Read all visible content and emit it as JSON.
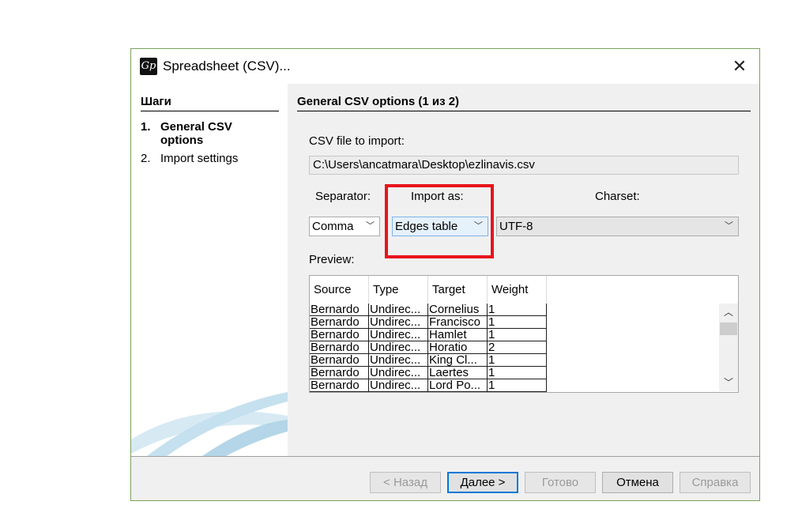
{
  "window": {
    "title": "Spreadsheet (CSV)...",
    "app_icon_glyph": "Gp"
  },
  "steps": {
    "heading": "Шаги",
    "items": [
      {
        "num": "1.",
        "label": "General CSV options"
      },
      {
        "num": "2.",
        "label": "Import settings"
      }
    ]
  },
  "main": {
    "title": "General CSV options (1 из 2)",
    "file_label": "CSV file to import:",
    "file_path": "C:\\Users\\ancatmara\\Desktop\\ezlinavis.csv",
    "separator_label": "Separator:",
    "import_as_label": "Import as:",
    "charset_label": "Charset:",
    "separator_value": "Comma",
    "import_as_value": "Edges table",
    "charset_value": "UTF-8",
    "preview_label": "Preview:"
  },
  "preview": {
    "columns": [
      "Source",
      "Type",
      "Target",
      "Weight"
    ],
    "rows": [
      [
        "Bernardo",
        "Undirec...",
        "Cornelius",
        "1"
      ],
      [
        "Bernardo",
        "Undirec...",
        "Francisco",
        "1"
      ],
      [
        "Bernardo",
        "Undirec...",
        "Hamlet",
        "1"
      ],
      [
        "Bernardo",
        "Undirec...",
        "Horatio",
        "2"
      ],
      [
        "Bernardo",
        "Undirec...",
        "King Cl...",
        "1"
      ],
      [
        "Bernardo",
        "Undirec...",
        "Laertes",
        "1"
      ],
      [
        "Bernardo",
        "Undirec...",
        "Lord Po...",
        "1"
      ]
    ]
  },
  "buttons": {
    "back": "< Назад",
    "next": "Далее >",
    "finish": "Готово",
    "cancel": "Отмена",
    "help": "Справка"
  },
  "icons": {
    "close": "close-icon",
    "chevron": "chevron-down-icon",
    "scroll_up": "chevron-up-icon",
    "scroll_down": "chevron-down-icon"
  },
  "colors": {
    "highlight": "#e8141c",
    "window_border": "#7aa35a",
    "default_button_border": "#0078d7"
  }
}
